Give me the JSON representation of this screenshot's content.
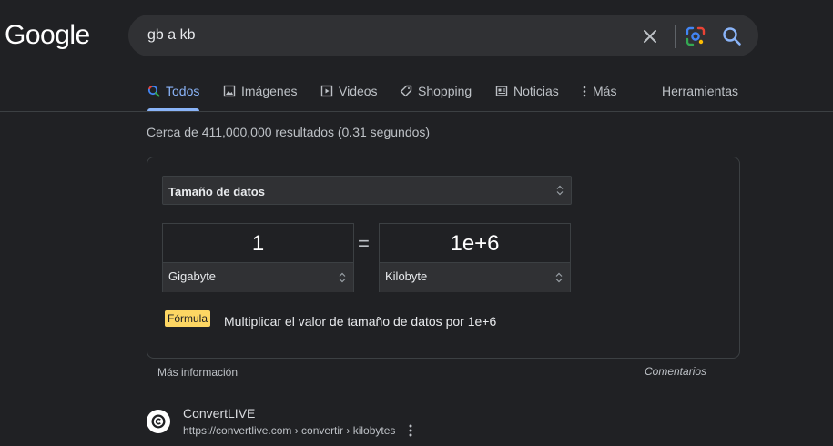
{
  "logo": "Google",
  "search": {
    "query": "gb a kb"
  },
  "tabs": [
    {
      "label": "Todos",
      "icon": "search-icon",
      "active": true
    },
    {
      "label": "Imágenes",
      "icon": "image-icon"
    },
    {
      "label": "Videos",
      "icon": "play-icon"
    },
    {
      "label": "Shopping",
      "icon": "tag-icon"
    },
    {
      "label": "Noticias",
      "icon": "news-icon"
    },
    {
      "label": "Más",
      "icon": "more-vert-icon"
    },
    {
      "label": "Herramientas"
    }
  ],
  "stats": "Cerca de 411,000,000 resultados (0.31 segundos)",
  "converter": {
    "category": "Tamaño de datos",
    "from_value": "1",
    "from_unit": "Gigabyte",
    "equals": "=",
    "to_value": "1e+6",
    "to_unit": "Kilobyte",
    "formula_label": "Fórmula",
    "formula_text": "Multiplicar el valor de tamaño de datos por 1e+6"
  },
  "footer": {
    "more_info": "Más información",
    "feedback": "Comentarios"
  },
  "result": {
    "site": "ConvertLIVE",
    "url": "https://convertlive.com › convertir › kilobytes"
  },
  "colors": {
    "background": "#202124",
    "accent": "#8ab4f8",
    "formula_badge": "#fdd663"
  }
}
